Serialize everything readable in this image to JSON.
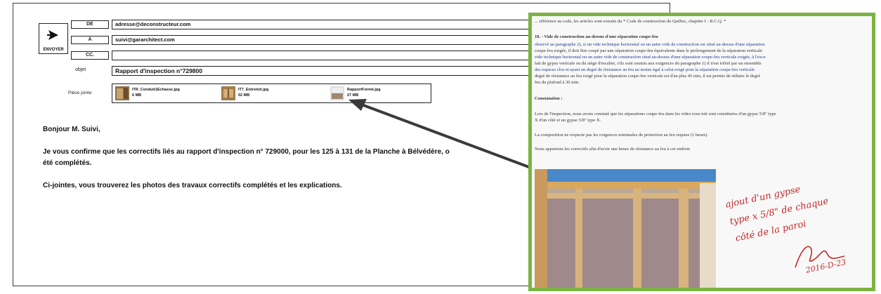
{
  "email": {
    "send_label": "ENVOYER",
    "from_label": "DE",
    "from_value": "adresse@deconstructeur.com",
    "to_label": "À",
    "to_value": "suivi@gararchitect.com",
    "cc_label": "CC.",
    "cc_value": "",
    "subject_label": "objet",
    "subject_value": "Rapport d'inspection n°729800",
    "attachments_label": "Pièce jointe",
    "attachments": [
      {
        "name": "ITR_Conduit1Echasse.jpg",
        "size": "6 MB"
      },
      {
        "name": "IT7_Entretoit.jpg",
        "size": "52 MB"
      },
      {
        "name": "RapportFormé.jpg",
        "size": "27 MB"
      }
    ],
    "greeting": "Bonjour M. Suivi,",
    "paragraph1_line1": "Je vous confirme que les correctifs liés au rapport d'inspection n° 729000, pour les 125 à 131 de la Planche à Bélvédère, o",
    "paragraph1_line2": "été complétés.",
    "paragraph2": "Ci-jointes, vous trouverez les photos des travaux correctifs complétés et les explications."
  },
  "document": {
    "lines": [
      "... référence au code, les articles sont extraits du * Code de construction du Québec, chapitre I - B.C.Q. *",
      "",
      "10. - Vide de construction au-dessus d'une séparation coupe-feu",
      "observé au paragraphe 2), si un vide technique horizontal ou un autre vide de construction est situé au-dessus d'une séparation",
      "coupe-feu exigée, il doit être coupé par une séparation coupe-feu équivalente dans le prolongement de la séparation verticale",
      "vide technique horizontal ou un autre vide de construction situé au-dessus d'une séparation coupe-feu verticale exigée, à l'exce",
      "fait de gypse verticale ou du siège d'escalier, s'ils sont soumis aux exigences du paragraphe 1) il n'est toléré par un ensemble",
      "des espaces clos et ayant un degré de résistance au feu au moins égal à celui exigé pour la séparation coupe-feu verticale",
      "degré de résistance au feu exigé pour la séparation coupe-feu verticale est d'au plus 45 min, il est permis de réduire le degré",
      "feu du plafond à 30 min.",
      "",
      "Constatation :",
      "",
      "Lors de l'inspection, nous avons constaté que les séparations coupe-feu dans les vides sous toit sont constituées d'un gypse 5/8\" type",
      "X d'un côté et un gypse 5/8\" type X.",
      "",
      "La composition ne respecte pas les exigences minimales de protection au feu requise (1 heure).",
      "",
      "Nous apportons les correctifs afin d'avoir une heure de résistance au feu à cet endroit."
    ],
    "handwriting": [
      "ajout d'un gypse",
      "type x 5/8\" de chaque",
      "côté de la paroi"
    ],
    "signature_date": "2016-D-23"
  }
}
